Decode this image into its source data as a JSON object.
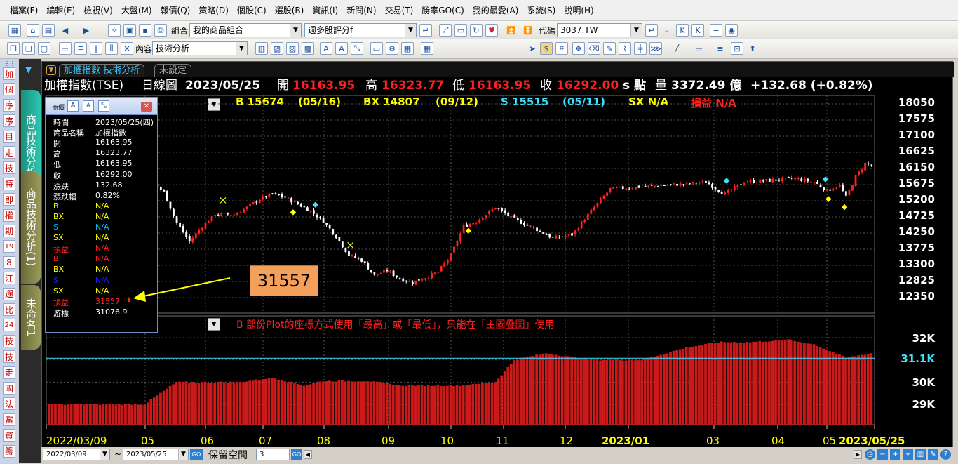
{
  "menu": [
    "檔案(F)",
    "編輯(E)",
    "檢視(V)",
    "大盤(M)",
    "報價(Q)",
    "策略(D)",
    "個股(C)",
    "選股(B)",
    "資訊(I)",
    "新聞(N)",
    "交易(T)",
    "勝率GO(C)",
    "我的最愛(A)",
    "系統(S)",
    "說明(H)"
  ],
  "toolbar": {
    "portfolio_label": "組合",
    "portfolio_value": "我的商品組合",
    "rating_value": "週多股評分f",
    "code_label": "代碼",
    "code_value": "3037.TW",
    "content_label": "內容",
    "content_value": "技術分析"
  },
  "left_items": [
    "加",
    "個",
    "序",
    "序",
    "目",
    "走",
    "技",
    "特",
    "即",
    "權",
    "期",
    "19",
    "8",
    "江",
    "遛",
    "比",
    "24",
    "技",
    "技",
    "走",
    "國",
    "法",
    "當",
    "資",
    "籌"
  ],
  "side_tabs": [
    "商品技術分析",
    "商品技術分析(1)",
    "未命名1"
  ],
  "chart_tabs": [
    "加權指數 技術分析",
    "未設定"
  ],
  "header": {
    "name": "加權指數(TSE)",
    "chart_type": "日線圖",
    "date": "2023/05/25",
    "open_label": "開",
    "open": "16163.95",
    "high_label": "高",
    "high": "16323.77",
    "low_label": "低",
    "low": "16163.95",
    "close_label": "收",
    "close": "16292.00",
    "unit": "s 點",
    "vol_label": "量",
    "vol": "3372.49 億",
    "change": "+132.68 (+0.82%)"
  },
  "signals": {
    "b": "B 15674",
    "b_date": "(05/16)",
    "bx": "BX 14807",
    "bx_date": "(09/12)",
    "s": "S 15515",
    "s_date": "(05/11)",
    "sx": "SX N/A",
    "pl": "損益 N/A"
  },
  "warning": "B 部份Plot的座標方式使用「最高」或「最低」，只能在「主圖疊圖」使用",
  "popup": {
    "title": "商價",
    "rows": [
      {
        "k": "時間",
        "v": "2023/05/25(四)",
        "c": "#ffffff"
      },
      {
        "k": "商品名稱",
        "v": "加權指數",
        "c": "#ffffff"
      },
      {
        "k": "開",
        "v": "16163.95",
        "c": "#ffffff"
      },
      {
        "k": "高",
        "v": "16323.77",
        "c": "#ffffff"
      },
      {
        "k": "低",
        "v": "16163.95",
        "c": "#ffffff"
      },
      {
        "k": "收",
        "v": "16292.00",
        "c": "#ffffff"
      },
      {
        "k": "漲跌",
        "v": "132.68",
        "c": "#ffffff"
      },
      {
        "k": "漲跌幅",
        "v": "0.82%",
        "c": "#ffffff"
      },
      {
        "k": "B",
        "v": "N/A",
        "c": "#ffff00"
      },
      {
        "k": "BX",
        "v": "N/A",
        "c": "#ffff00"
      },
      {
        "k": "S",
        "v": "N/A",
        "c": "#00bfff"
      },
      {
        "k": "SX",
        "v": "N/A",
        "c": "#ffff00"
      },
      {
        "k": "損益",
        "v": "N/A",
        "c": "#ff2020"
      },
      {
        "k": "B",
        "v": "N/A",
        "c": "#ff2020"
      },
      {
        "k": "BX",
        "v": "N/A",
        "c": "#ffff00"
      },
      {
        "k": "S",
        "v": "N/A",
        "c": "#2020ff"
      },
      {
        "k": "SX",
        "v": "N/A",
        "c": "#ffff00"
      },
      {
        "k": "損益",
        "v": "31557",
        "c": "#ff2020"
      },
      {
        "k": "游標",
        "v": "31076.9",
        "c": "#ffffff"
      }
    ]
  },
  "callout": "31557",
  "price_axis": [
    "18050",
    "17575",
    "17100",
    "16625",
    "16150",
    "15675",
    "15200",
    "14725",
    "14250",
    "13775",
    "13300",
    "12825",
    "12350"
  ],
  "lower_axis": [
    "32K",
    "31.1K",
    "30K",
    "29K"
  ],
  "x_axis": [
    "2022/03/09",
    "05",
    "06",
    "07",
    "08",
    "09",
    "10",
    "11",
    "12",
    "2023/01",
    "03",
    "04",
    "05",
    "2023/05/25"
  ],
  "bottom": {
    "from": "2022/03/09",
    "to": "2023/05/25",
    "go": "GO",
    "reserve_label": "保留空間",
    "reserve_value": "3"
  },
  "chart_data": {
    "type": "bar",
    "title": "",
    "y_range_price": [
      12350,
      18050
    ],
    "lower_range": [
      29000,
      32000
    ],
    "cursor_value": 31076.9,
    "close_anchors": [
      [
        0,
        16150
      ],
      [
        8,
        16300
      ],
      [
        12,
        16000
      ],
      [
        18,
        16250
      ],
      [
        22,
        16650
      ],
      [
        26,
        16550
      ],
      [
        30,
        15900
      ],
      [
        36,
        15450
      ],
      [
        40,
        14550
      ],
      [
        44,
        14000
      ],
      [
        48,
        14450
      ],
      [
        52,
        14800
      ],
      [
        58,
        14800
      ],
      [
        62,
        15000
      ],
      [
        66,
        15250
      ],
      [
        70,
        15400
      ],
      [
        74,
        15300
      ],
      [
        78,
        15100
      ],
      [
        82,
        14900
      ],
      [
        86,
        14600
      ],
      [
        90,
        14150
      ],
      [
        94,
        13600
      ],
      [
        98,
        13450
      ],
      [
        102,
        13000
      ],
      [
        106,
        13150
      ],
      [
        110,
        12900
      ],
      [
        114,
        12800
      ],
      [
        118,
        12950
      ],
      [
        122,
        13100
      ],
      [
        126,
        13600
      ],
      [
        130,
        14450
      ],
      [
        134,
        14600
      ],
      [
        140,
        15000
      ],
      [
        146,
        14650
      ],
      [
        152,
        14400
      ],
      [
        158,
        14100
      ],
      [
        164,
        14200
      ],
      [
        170,
        14900
      ],
      [
        176,
        15550
      ],
      [
        184,
        15600
      ],
      [
        192,
        15650
      ],
      [
        200,
        15700
      ],
      [
        206,
        15750
      ],
      [
        212,
        15400
      ],
      [
        218,
        15750
      ],
      [
        226,
        15800
      ],
      [
        234,
        15850
      ],
      [
        240,
        15750
      ],
      [
        244,
        15500
      ],
      [
        248,
        15650
      ],
      [
        250,
        15300
      ],
      [
        253,
        15900
      ],
      [
        256,
        16300
      ],
      [
        258,
        16250
      ]
    ],
    "pl_anchors": [
      [
        0,
        29000
      ],
      [
        30,
        29000
      ],
      [
        36,
        29600
      ],
      [
        40,
        30000
      ],
      [
        60,
        30000
      ],
      [
        70,
        30200
      ],
      [
        80,
        29850
      ],
      [
        86,
        30050
      ],
      [
        100,
        30050
      ],
      [
        110,
        29850
      ],
      [
        130,
        29850
      ],
      [
        140,
        30000
      ],
      [
        146,
        31000
      ],
      [
        156,
        31300
      ],
      [
        170,
        31000
      ],
      [
        186,
        31000
      ],
      [
        200,
        31550
      ],
      [
        210,
        31800
      ],
      [
        220,
        31800
      ],
      [
        232,
        31900
      ],
      [
        240,
        31700
      ],
      [
        250,
        31100
      ],
      [
        258,
        31300
      ]
    ]
  }
}
